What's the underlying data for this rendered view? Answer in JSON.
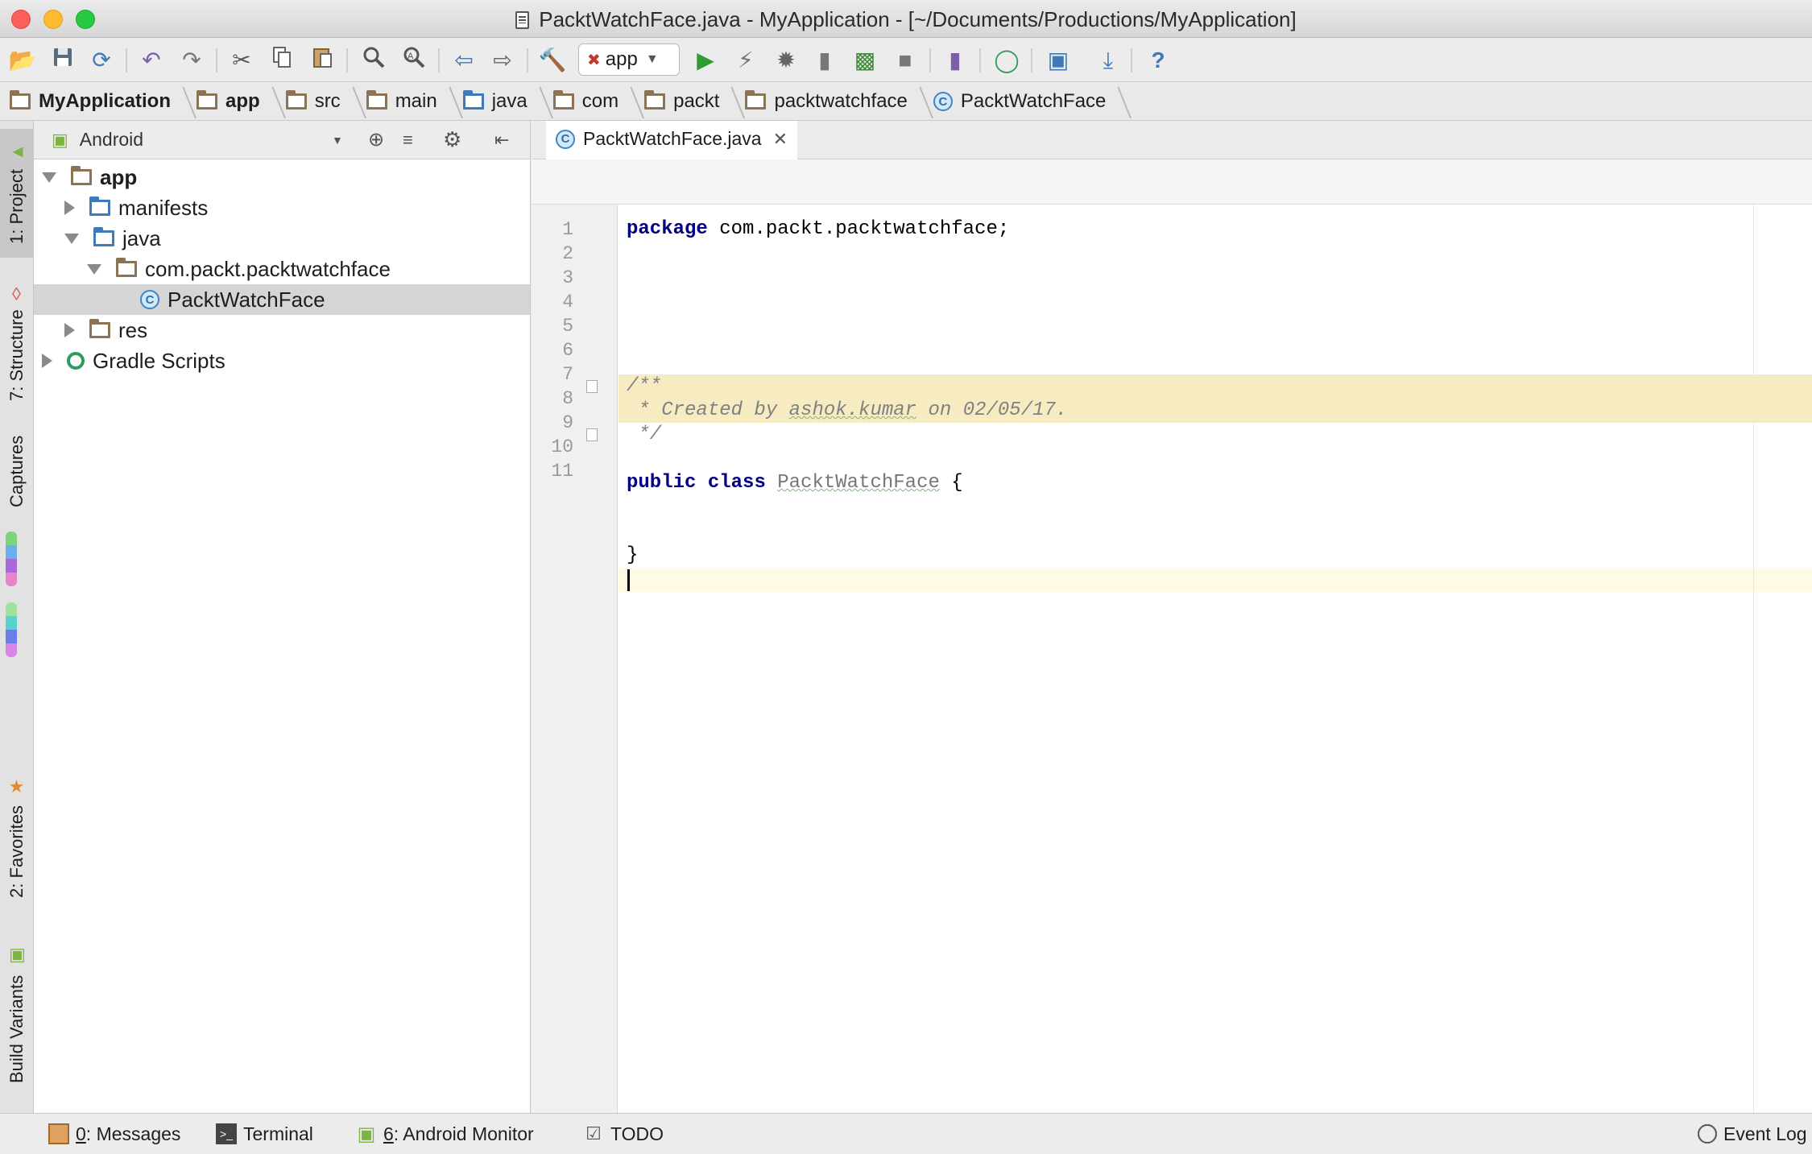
{
  "window": {
    "title": "PacktWatchFace.java - MyApplication - [~/Documents/Productions/MyApplication]"
  },
  "toolbar": {
    "run_config": "app"
  },
  "breadcrumbs": [
    {
      "label": "MyApplication",
      "icon": "module-folder-icon",
      "bold": true
    },
    {
      "label": "app",
      "icon": "module-folder-icon",
      "bold": true
    },
    {
      "label": "src",
      "icon": "folder-icon"
    },
    {
      "label": "main",
      "icon": "folder-icon"
    },
    {
      "label": "java",
      "icon": "source-folder-icon"
    },
    {
      "label": "com",
      "icon": "package-icon"
    },
    {
      "label": "packt",
      "icon": "package-icon"
    },
    {
      "label": "packtwatchface",
      "icon": "package-icon"
    },
    {
      "label": "PacktWatchFace",
      "icon": "class-icon"
    }
  ],
  "left_tools": {
    "project": "1: Project",
    "structure": "7: Structure",
    "captures": "Captures",
    "favorites": "2: Favorites",
    "build_variants": "Build Variants"
  },
  "project_panel": {
    "view_mode": "Android",
    "tree": [
      {
        "label": "app",
        "depth": 0,
        "expanded": true,
        "bold": true,
        "icon": "module-folder-icon"
      },
      {
        "label": "manifests",
        "depth": 1,
        "expanded": false,
        "icon": "folder-icon"
      },
      {
        "label": "java",
        "depth": 1,
        "expanded": true,
        "icon": "source-folder-icon"
      },
      {
        "label": "com.packt.packtwatchface",
        "depth": 2,
        "expanded": true,
        "icon": "package-icon"
      },
      {
        "label": "PacktWatchFace",
        "depth": 3,
        "selected": true,
        "icon": "class-icon"
      },
      {
        "label": "res",
        "depth": 1,
        "expanded": false,
        "icon": "res-folder-icon"
      },
      {
        "label": "Gradle Scripts",
        "depth": 0,
        "expanded": false,
        "icon": "gradle-icon"
      }
    ]
  },
  "editor": {
    "tab_label": "PacktWatchFace.java",
    "line_numbers": [
      "1",
      "2",
      "3",
      "4",
      "5",
      "6",
      "7",
      "8",
      "9",
      "10",
      "11"
    ],
    "lines": {
      "l1_kw": "package",
      "l1_rest": " com.packt.packtwatchface;",
      "l3": "/**",
      "l4_a": " * Created by ",
      "l4_b": "ashok.kumar",
      "l4_c": " on 02/05/17.",
      "l5": " */",
      "l7_kw1": "public",
      "l7_kw2": "class",
      "l7_name": "PacktWatchFace",
      "l7_rest": " {",
      "l10": "}"
    }
  },
  "bottom_tools": {
    "messages_num": "0",
    "messages": ": Messages",
    "terminal": "Terminal",
    "monitor_num": "6",
    "monitor": ": Android Monitor",
    "todo": "TODO",
    "event_log": "Event Log"
  },
  "colors": {
    "keyword": "#000080",
    "comment": "#808080",
    "comment_bg": "#f6ebc1",
    "caret_line": "#fffae3",
    "selection": "#d5d5d5"
  }
}
